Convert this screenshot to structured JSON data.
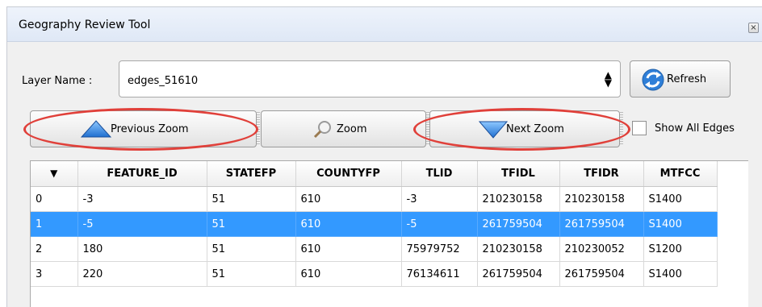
{
  "window": {
    "title": "Geography Review Tool",
    "close_glyph": "×"
  },
  "layer": {
    "label": "Layer Name :",
    "value": "edges_51610",
    "arrows_glyph": "⬍"
  },
  "buttons": {
    "refresh": "Refresh",
    "previous_zoom": "Previous Zoom",
    "zoom": "Zoom",
    "next_zoom": "Next Zoom"
  },
  "show_all_edges": {
    "label": "Show All Edges",
    "checked": false
  },
  "table": {
    "corner_glyph": "⌄",
    "columns": [
      "FEATURE_ID",
      "STATEFP",
      "COUNTYFP",
      "TLID",
      "TFIDL",
      "TFIDR",
      "MTFCC"
    ],
    "rows": [
      {
        "index": "0",
        "cells": [
          "-3",
          "51",
          "610",
          "-3",
          "210230158",
          "210230158",
          "S1400"
        ],
        "selected": false
      },
      {
        "index": "1",
        "cells": [
          "-5",
          "51",
          "610",
          "-5",
          "261759504",
          "261759504",
          "S1400"
        ],
        "selected": true
      },
      {
        "index": "2",
        "cells": [
          "180",
          "51",
          "610",
          "75979752",
          "210230158",
          "210230052",
          "S1200"
        ],
        "selected": false
      },
      {
        "index": "3",
        "cells": [
          "220",
          "51",
          "610",
          "76134611",
          "261759504",
          "261759504",
          "S1400"
        ],
        "selected": false
      }
    ]
  },
  "colors": {
    "selection": "#3399ff",
    "highlight_oval": "#e0403a",
    "accent_blue": "#2f7fd8"
  },
  "icons": {
    "refresh": "refresh-icon",
    "previous_zoom": "triangle-up-icon",
    "zoom": "magnifier-icon",
    "next_zoom": "triangle-down-icon"
  }
}
